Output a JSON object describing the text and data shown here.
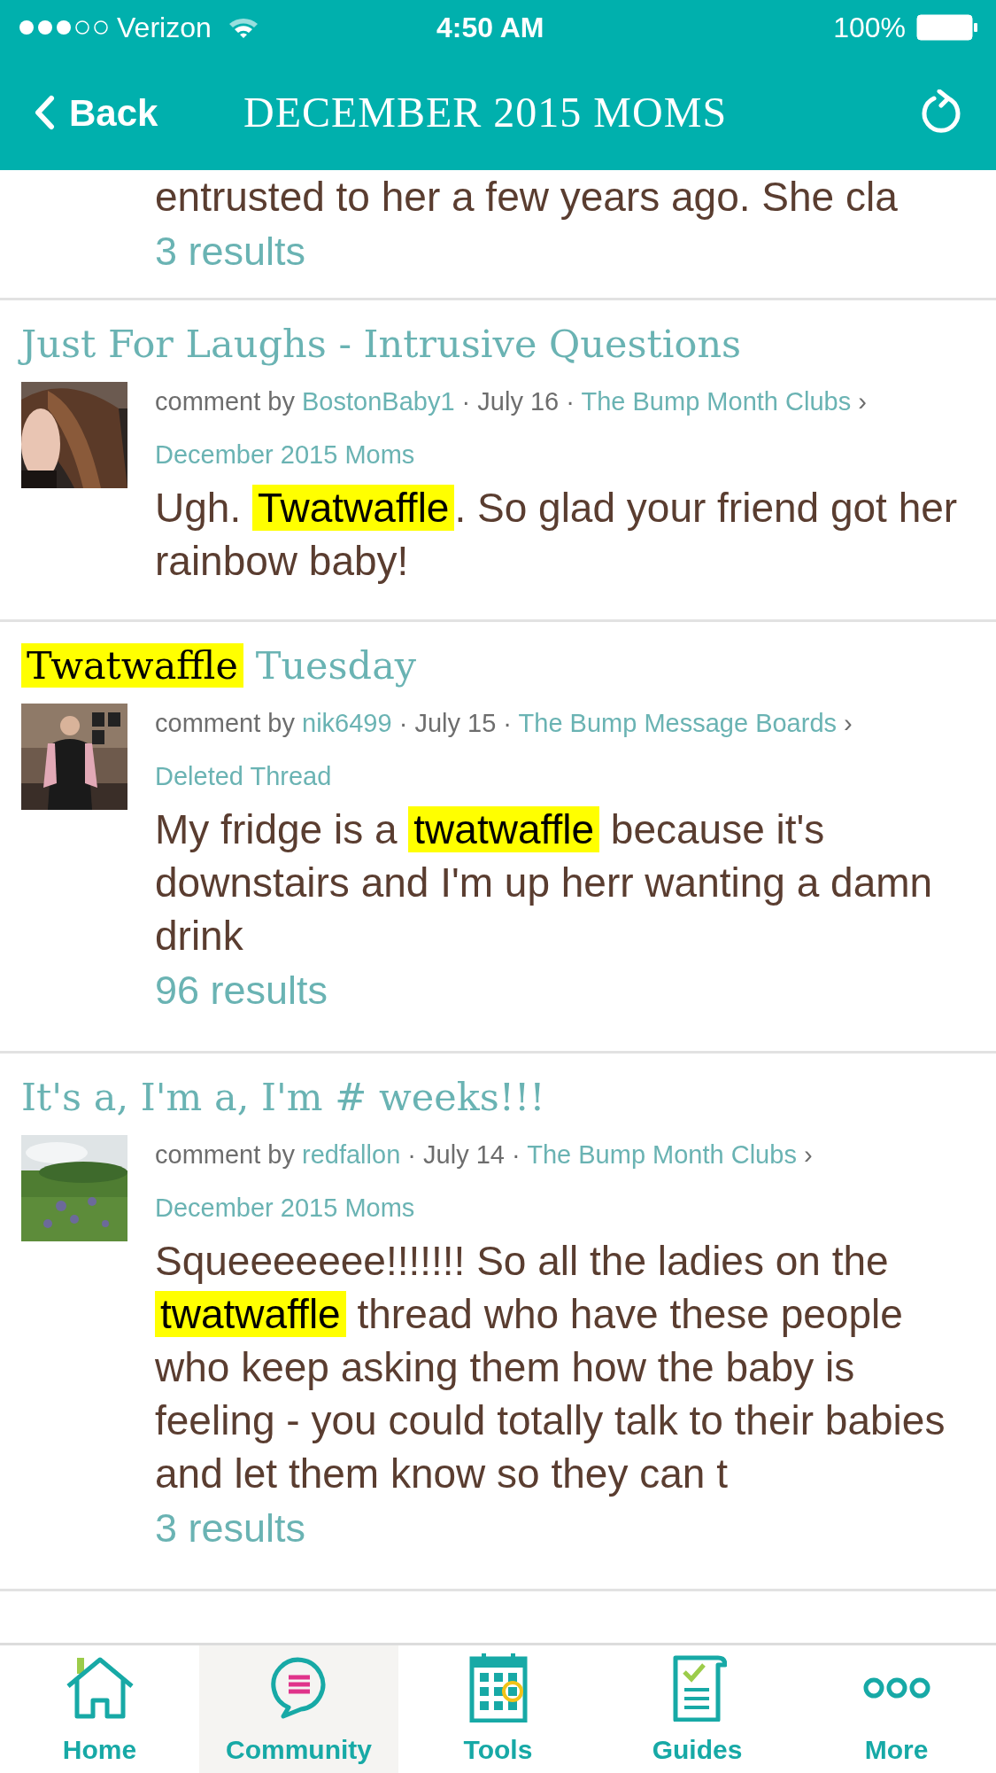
{
  "status_bar": {
    "carrier": "Verizon",
    "time": "4:50 AM",
    "battery": "100%"
  },
  "nav_bar": {
    "back": "Back",
    "title": "DECEMBER 2015 MOMS"
  },
  "results": [
    {
      "body": [
        {
          "text": "entrusted to her a few years ago. She cla",
          "highlighted": false
        }
      ],
      "count": "3 results"
    },
    {
      "title": [
        {
          "text": "Just For Laughs - Intrusive Questions",
          "highlighted": false
        }
      ],
      "avatar": {
        "kind": "picture"
      },
      "meta": {
        "prefix": "comment by",
        "author": "BostonBaby1",
        "dot_1": "·",
        "date": "July 16",
        "dot_2": "·",
        "board": "The Bump Month Clubs",
        "separator": "›",
        "subboard": "December 2015 Moms"
      },
      "body": [
        {
          "text": "Ugh. ",
          "highlighted": false
        },
        {
          "text": "Twatwaffle",
          "highlighted": true
        },
        {
          "text": ". So glad your friend got her rainbow baby!",
          "highlighted": false
        }
      ]
    },
    {
      "title": [
        {
          "text": "Twatwaffle",
          "highlighted": true
        },
        {
          "text": " Tuesday",
          "highlighted": false
        }
      ],
      "avatar": {
        "kind": "picture"
      },
      "meta": {
        "prefix": "comment by",
        "author": "nik6499",
        "dot_1": "·",
        "date": "July 15",
        "dot_2": "·",
        "board": "The Bump Message Boards",
        "separator": "›",
        "subboard": "Deleted Thread"
      },
      "body": [
        {
          "text": "My fridge is a ",
          "highlighted": false
        },
        {
          "text": "twatwaffle",
          "highlighted": true
        },
        {
          "text": " because it's downstairs and I'm up herr wanting a damn drink",
          "highlighted": false
        }
      ],
      "count": "96 results"
    },
    {
      "title": [
        {
          "text": "It's a, I'm a, I'm # weeks!!!",
          "highlighted": false
        }
      ],
      "avatar": {
        "kind": "picture"
      },
      "meta": {
        "prefix": "comment by",
        "author": "redfallon",
        "dot_1": "·",
        "date": "July 14",
        "dot_2": "·",
        "board": "The Bump Month Clubs",
        "separator": "›",
        "subboard": "December 2015 Moms"
      },
      "body": [
        {
          "text": "Squeeeeeee!!!!!!! So all the ladies on the ",
          "highlighted": false
        },
        {
          "text": "twatwaffle",
          "highlighted": true
        },
        {
          "text": " thread who have these people who keep asking them how the baby is feeling - you could totally talk to their babies and let them know so they can t",
          "highlighted": false
        }
      ],
      "count": "3 results"
    }
  ],
  "tab_bar": [
    {
      "label": "Home",
      "kind": "home",
      "selected": false
    },
    {
      "label": "Community",
      "kind": "community",
      "selected": true
    },
    {
      "label": "Tools",
      "kind": "tools",
      "selected": false
    },
    {
      "label": "Guides",
      "kind": "guides",
      "selected": false
    },
    {
      "label": "More",
      "kind": "more",
      "selected": false
    }
  ]
}
